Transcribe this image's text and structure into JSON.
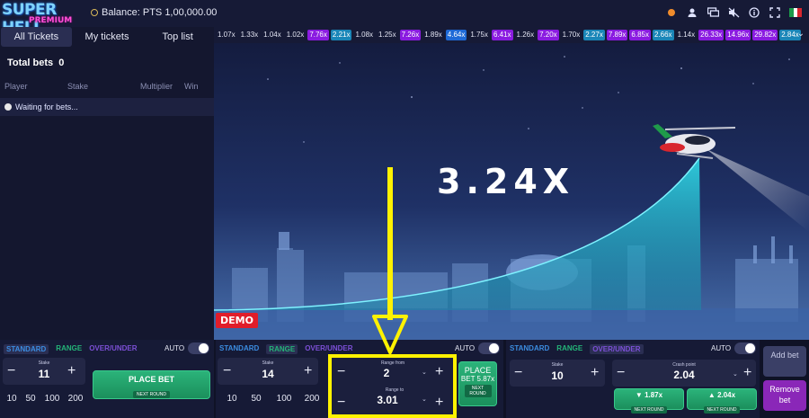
{
  "brand": {
    "logo_line1": "SUPER HELI",
    "logo_line2": "PREMIUM"
  },
  "header": {
    "balance_label": "Balance: PTS 1,00,000.00",
    "icons": [
      "status-dot-icon",
      "user-icon",
      "chat-icon",
      "sound-off-icon",
      "info-icon",
      "fullscreen-icon",
      "italy-flag-icon"
    ]
  },
  "sidebar": {
    "tabs": [
      {
        "label": "All Tickets",
        "active": true
      },
      {
        "label": "My tickets",
        "active": false
      },
      {
        "label": "Top list",
        "active": false
      }
    ],
    "total_bets_label": "Total bets",
    "total_bets_value": "0",
    "columns": [
      "Player",
      "Stake",
      "Multiplier",
      "Win"
    ],
    "waiting_text": "Waiting for bets..."
  },
  "history": [
    {
      "v": "1.07x",
      "c": "grey"
    },
    {
      "v": "1.33x",
      "c": "grey"
    },
    {
      "v": "1.04x",
      "c": "grey"
    },
    {
      "v": "1.02x",
      "c": "grey"
    },
    {
      "v": "7.76x",
      "c": "purple"
    },
    {
      "v": "2.21x",
      "c": "teal"
    },
    {
      "v": "1.08x",
      "c": "grey"
    },
    {
      "v": "1.25x",
      "c": "grey"
    },
    {
      "v": "7.26x",
      "c": "purple"
    },
    {
      "v": "1.89x",
      "c": "grey"
    },
    {
      "v": "4.64x",
      "c": "blue"
    },
    {
      "v": "1.75x",
      "c": "grey"
    },
    {
      "v": "6.41x",
      "c": "purple"
    },
    {
      "v": "1.26x",
      "c": "grey"
    },
    {
      "v": "7.20x",
      "c": "purple"
    },
    {
      "v": "1.70x",
      "c": "grey"
    },
    {
      "v": "2.27x",
      "c": "teal"
    },
    {
      "v": "7.89x",
      "c": "purple"
    },
    {
      "v": "6.85x",
      "c": "purple"
    },
    {
      "v": "2.66x",
      "c": "teal"
    },
    {
      "v": "1.14x",
      "c": "grey"
    },
    {
      "v": "26.33x",
      "c": "purple"
    },
    {
      "v": "14.96x",
      "c": "purple"
    },
    {
      "v": "29.82x",
      "c": "purple"
    },
    {
      "v": "2.84x",
      "c": "teal"
    }
  ],
  "game": {
    "multiplier": "3.24X",
    "demo_label": "DEMO"
  },
  "modes": {
    "standard": "STANDARD",
    "range": "RANGE",
    "over_under": "OVER/UNDER",
    "auto": "AUTO"
  },
  "panel1": {
    "stake_label": "Stake",
    "stake_value": "11",
    "quick": [
      "10",
      "50",
      "100",
      "200"
    ],
    "place_bet": "PLACE BET",
    "next_round": "NEXT ROUND"
  },
  "panel2": {
    "stake_label": "Stake",
    "stake_value": "14",
    "quick": [
      "10",
      "50",
      "100",
      "200"
    ],
    "range_from_label": "Range from",
    "range_from_value": "2",
    "range_to_label": "Range to",
    "range_to_value": "3.01",
    "place_bet_line1": "PLACE",
    "place_bet_line2": "BET 5.87x",
    "next_round": "NEXT ROUND"
  },
  "panel3": {
    "stake_label": "Stake",
    "stake_value": "10",
    "crash_label": "Crash point",
    "crash_value": "2.04",
    "under_value": "1.87x",
    "over_value": "2.04x",
    "next_round": "NEXT ROUND"
  },
  "actions": {
    "add_bet": "Add bet",
    "remove_bet": "Remove bet"
  },
  "colors": {
    "accent_yellow": "#fff200",
    "demo_red": "#e11d2a",
    "place_green": "#1b8f5c",
    "remove_purple": "#8a27b8"
  }
}
